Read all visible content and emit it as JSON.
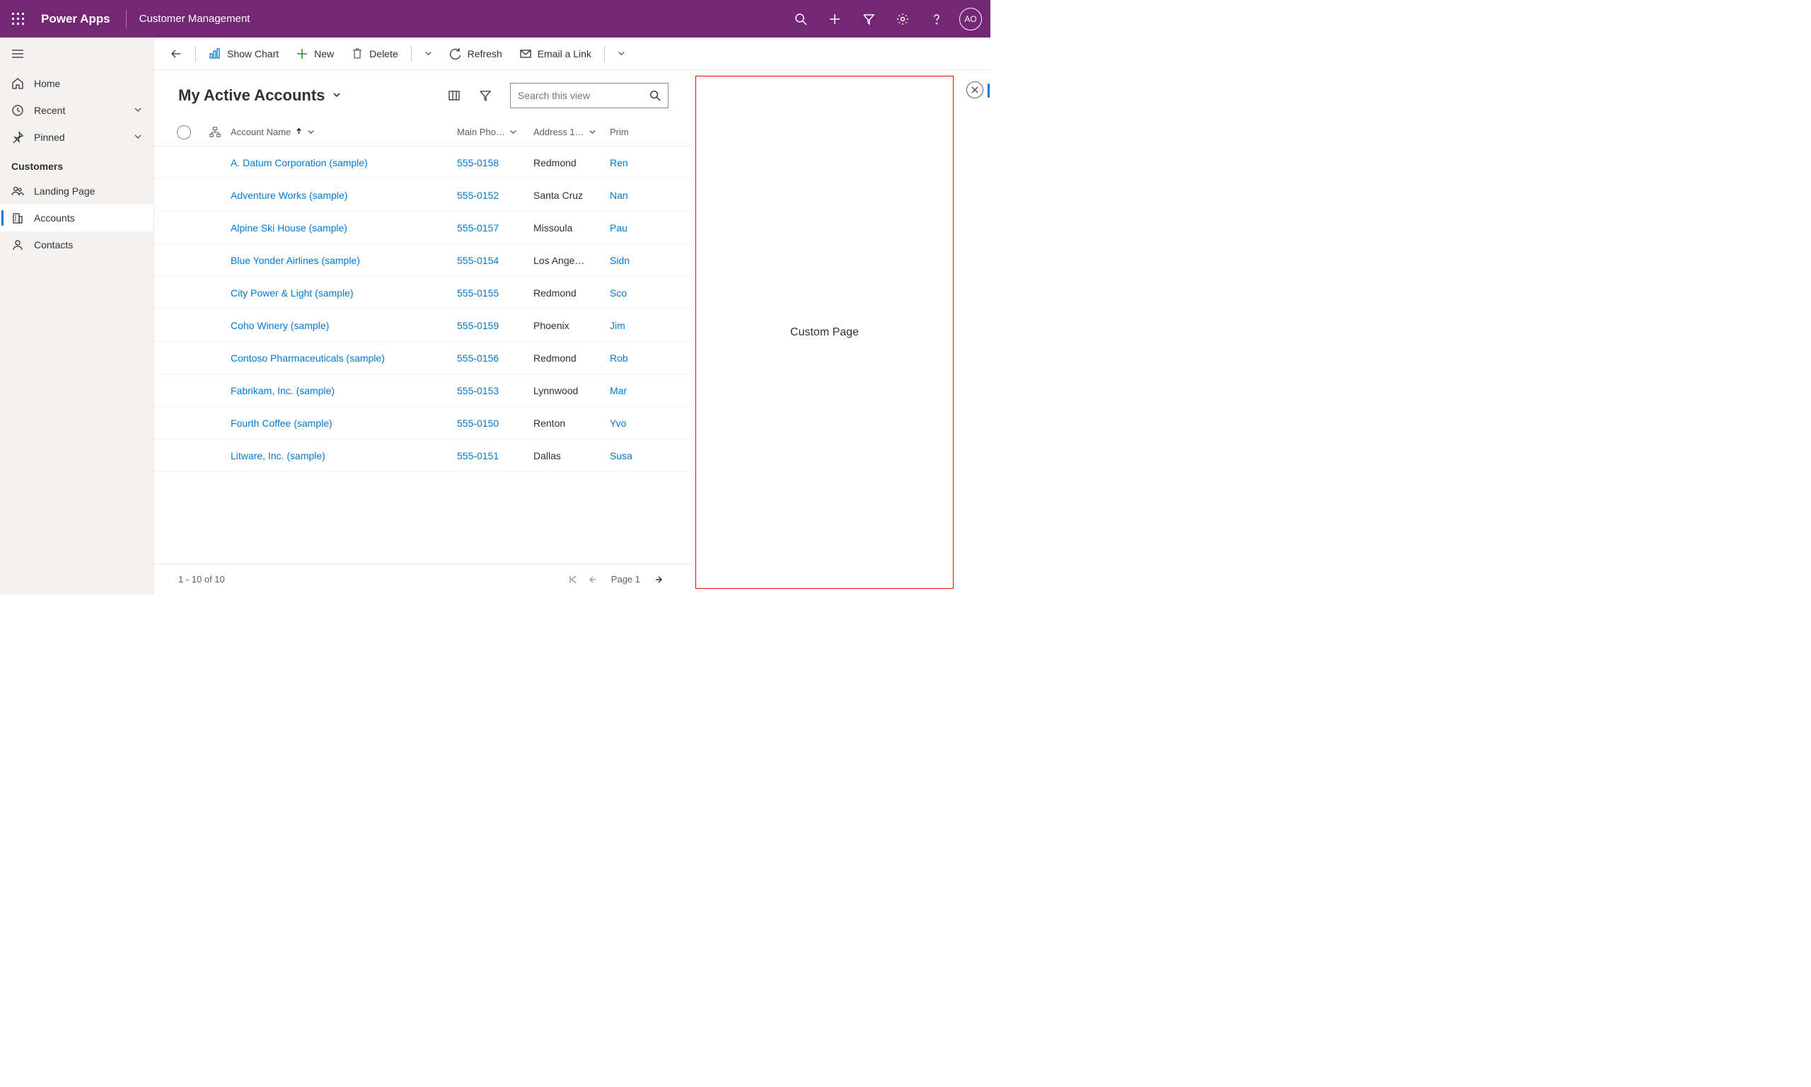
{
  "header": {
    "brand": "Power Apps",
    "app_name": "Customer Management",
    "avatar_initials": "AO"
  },
  "sidebar": {
    "top": [
      {
        "label": "Home",
        "icon": "home"
      },
      {
        "label": "Recent",
        "icon": "clock",
        "chevron": true
      },
      {
        "label": "Pinned",
        "icon": "pin",
        "chevron": true
      }
    ],
    "group_label": "Customers",
    "items": [
      {
        "label": "Landing Page",
        "icon": "people"
      },
      {
        "label": "Accounts",
        "icon": "building",
        "active": true
      },
      {
        "label": "Contacts",
        "icon": "person"
      }
    ]
  },
  "commands": {
    "show_chart": "Show Chart",
    "new": "New",
    "delete": "Delete",
    "refresh": "Refresh",
    "email_link": "Email a Link"
  },
  "view": {
    "title": "My Active Accounts",
    "search_placeholder": "Search this view",
    "columns": {
      "name": "Account Name",
      "phone": "Main Pho…",
      "addr": "Address 1…",
      "prim": "Prim"
    },
    "rows": [
      {
        "name": "A. Datum Corporation (sample)",
        "phone": "555-0158",
        "addr": "Redmond",
        "prim": "Ren"
      },
      {
        "name": "Adventure Works (sample)",
        "phone": "555-0152",
        "addr": "Santa Cruz",
        "prim": "Nan"
      },
      {
        "name": "Alpine Ski House (sample)",
        "phone": "555-0157",
        "addr": "Missoula",
        "prim": "Pau"
      },
      {
        "name": "Blue Yonder Airlines (sample)",
        "phone": "555-0154",
        "addr": "Los Ange…",
        "prim": "Sidn"
      },
      {
        "name": "City Power & Light (sample)",
        "phone": "555-0155",
        "addr": "Redmond",
        "prim": "Sco"
      },
      {
        "name": "Coho Winery (sample)",
        "phone": "555-0159",
        "addr": "Phoenix",
        "prim": "Jim"
      },
      {
        "name": "Contoso Pharmaceuticals (sample)",
        "phone": "555-0156",
        "addr": "Redmond",
        "prim": "Rob"
      },
      {
        "name": "Fabrikam, Inc. (sample)",
        "phone": "555-0153",
        "addr": "Lynnwood",
        "prim": "Mar"
      },
      {
        "name": "Fourth Coffee (sample)",
        "phone": "555-0150",
        "addr": "Renton",
        "prim": "Yvo"
      },
      {
        "name": "Litware, Inc. (sample)",
        "phone": "555-0151",
        "addr": "Dallas",
        "prim": "Susa"
      }
    ],
    "footer_count": "1 - 10 of 10",
    "page_label": "Page 1"
  },
  "side_panel": {
    "label": "Custom Page"
  }
}
